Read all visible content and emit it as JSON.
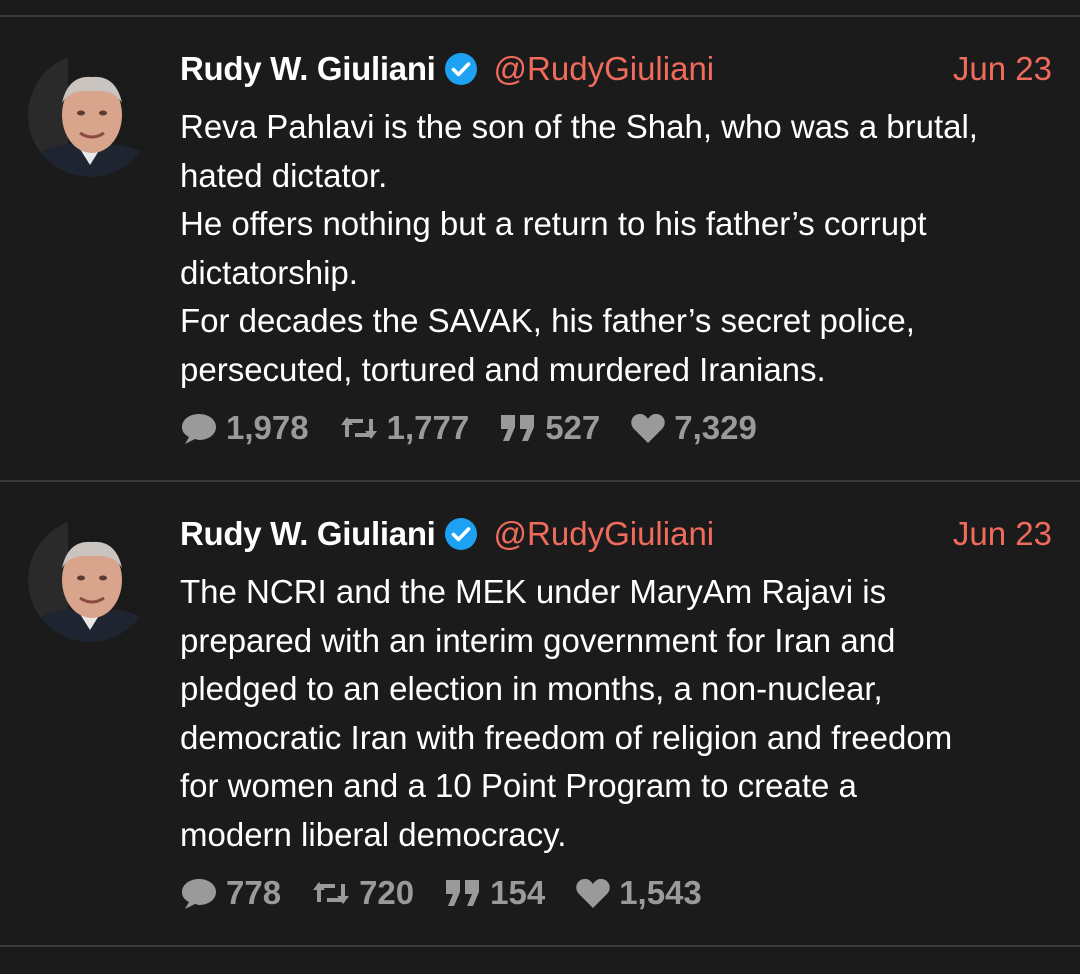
{
  "colors": {
    "background": "#1b1b1b",
    "accent": "#f06b5c",
    "verified": "#1da1f2",
    "muted": "#9a9a9a"
  },
  "tweets": [
    {
      "author": "Rudy W. Giuliani",
      "handle": "@RudyGiuliani",
      "date": "Jun 23",
      "lines": [
        "Reva Pahlavi is the son of the Shah, who was a brutal,",
        "hated dictator.",
        "He offers nothing but a return to his father’s  corrupt",
        "dictatorship.",
        "For decades the SAVAK, his father’s secret police,",
        "persecuted, tortured and murdered Iranians."
      ],
      "stats": {
        "replies": "1,978",
        "retweets": "1,777",
        "quotes": "527",
        "likes": "7,329"
      }
    },
    {
      "author": "Rudy W. Giuliani",
      "handle": "@RudyGiuliani",
      "date": "Jun 23",
      "lines": [
        "The NCRI and the MEK under MaryAm Rajavi is",
        "prepared with an interim government for Iran and",
        "pledged to an election in months, a non-nuclear,",
        "democratic Iran with freedom of religion and freedom",
        "for women and a 10 Point Program to create a",
        "modern liberal democracy."
      ],
      "stats": {
        "replies": "778",
        "retweets": "720",
        "quotes": "154",
        "likes": "1,543"
      }
    }
  ]
}
